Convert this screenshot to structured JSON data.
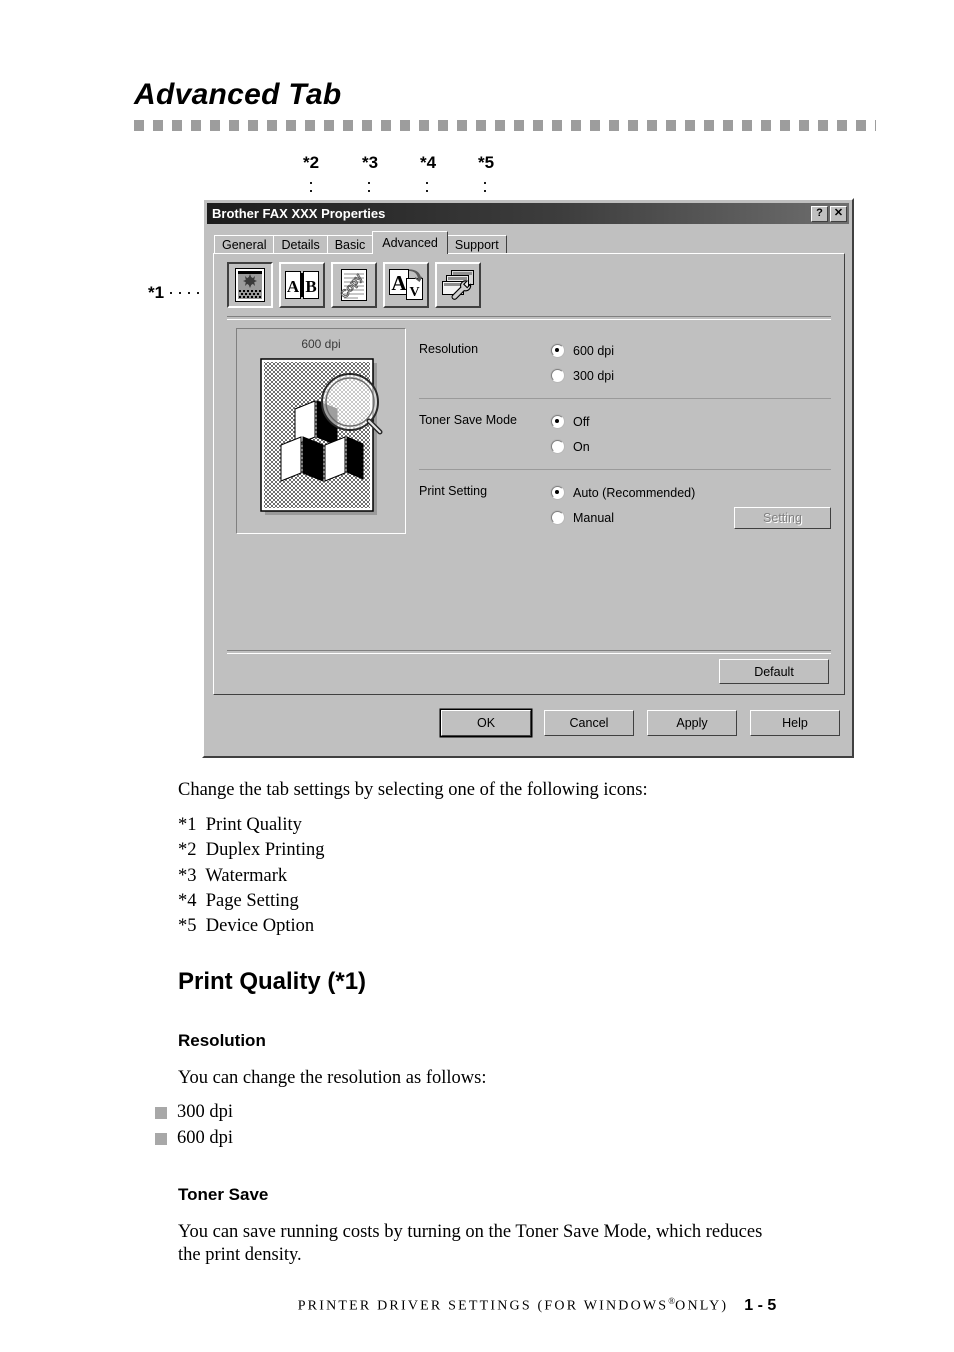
{
  "page": {
    "title": "Advanced Tab",
    "footer_text": "PRINTER DRIVER SETTINGS (FOR WINDOWS",
    "footer_text_tail": "ONLY)",
    "footer_reg": "®",
    "page_number": "1 - 5"
  },
  "callouts": {
    "c1": "*1",
    "c2": "*2",
    "c3": "*3",
    "c4": "*4",
    "c5": "*5"
  },
  "dialog": {
    "title": "Brother FAX XXX Properties",
    "help_button": "?",
    "close_button": "✕",
    "tabs": [
      {
        "label": "General",
        "active": false
      },
      {
        "label": "Details",
        "active": false
      },
      {
        "label": "Basic",
        "active": false
      },
      {
        "label": "Advanced",
        "active": true
      },
      {
        "label": "Support",
        "active": false
      }
    ],
    "toolbar_icons": [
      {
        "name": "print-quality-icon",
        "pressed": true
      },
      {
        "name": "duplex-printing-icon",
        "pressed": false
      },
      {
        "name": "watermark-icon",
        "pressed": false
      },
      {
        "name": "page-setting-icon",
        "pressed": false
      },
      {
        "name": "device-option-icon",
        "pressed": false
      }
    ],
    "preview": {
      "label": "600 dpi"
    },
    "settings": {
      "resolution": {
        "label": "Resolution",
        "options": [
          {
            "label": "600 dpi",
            "selected": true
          },
          {
            "label": "300 dpi",
            "selected": false
          }
        ]
      },
      "toner_save": {
        "label": "Toner Save Mode",
        "options": [
          {
            "label": "Off",
            "selected": true
          },
          {
            "label": "On",
            "selected": false
          }
        ]
      },
      "print_setting": {
        "label": "Print Setting",
        "options": [
          {
            "label": "Auto (Recommended)",
            "selected": true
          },
          {
            "label": "Manual",
            "selected": false
          }
        ],
        "setting_button": "Setting",
        "setting_button_enabled": false
      }
    },
    "default_button": "Default",
    "buttons": [
      {
        "label": "OK",
        "focused": true
      },
      {
        "label": "Cancel",
        "focused": false
      },
      {
        "label": "Apply",
        "focused": false
      },
      {
        "label": "Help",
        "focused": false
      }
    ]
  },
  "content": {
    "intro": "Change the tab settings by selecting one of the following icons:",
    "icon_list": [
      "*1  Print Quality",
      "*2  Duplex Printing",
      "*3  Watermark",
      "*4  Page Setting",
      "*5  Device Option"
    ],
    "section_heading": "Print Quality (*1)",
    "resolution_heading": "Resolution",
    "resolution_text": "You can change the resolution as follows:",
    "resolution_bullets": [
      "300 dpi",
      "600 dpi"
    ],
    "toner_heading": "Toner Save",
    "toner_text_line1": "You can save running costs by turning on the Toner Save Mode, which reduces",
    "toner_text_line2": "the print density."
  }
}
